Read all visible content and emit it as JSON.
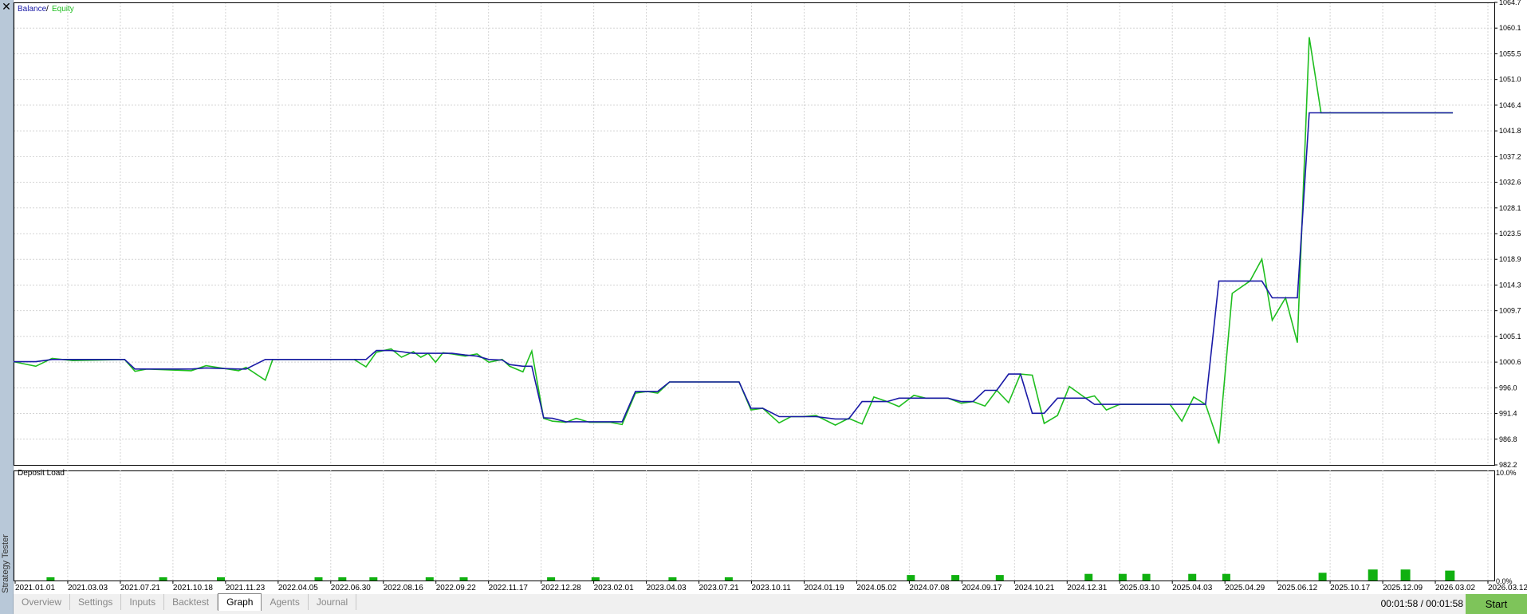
{
  "window": {
    "close_glyph": "✕",
    "side_title": "Strategy Tester"
  },
  "legend": {
    "balance": "Balance",
    "separator": " / ",
    "equity": "Equity"
  },
  "deposit": {
    "title": "Deposit Load",
    "axis_top": "10.0%",
    "axis_bottom": "0.0%"
  },
  "colors": {
    "balance": "#1a1aa6",
    "equity": "#1fbe1f",
    "deposit_bar": "#10b010",
    "grid": "#d4d4d4",
    "axis": "#000000",
    "start_button": "#7ec45a"
  },
  "chart_data": [
    {
      "type": "line",
      "title": "",
      "legend": [
        "Balance",
        "Equity"
      ],
      "y_ticks": [
        "1064.7",
        "1060.1",
        "1055.5",
        "1051.0",
        "1046.4",
        "1041.8",
        "1037.2",
        "1032.6",
        "1028.1",
        "1023.5",
        "1018.9",
        "1014.3",
        "1009.7",
        "1005.1",
        "1000.6",
        "996.0",
        "991.4",
        "986.8",
        "982.2"
      ],
      "ylim": [
        982.2,
        1064.7
      ],
      "x_ticks": [
        "2021.01.01",
        "2021.03.03",
        "2021.07.21",
        "2021.10.18",
        "2021.11.23",
        "2022.04.05",
        "2022.06.30",
        "2022.08.16",
        "2022.09.22",
        "2022.11.17",
        "2022.12.28",
        "2023.02.01",
        "2023.04.03",
        "2023.07.21",
        "2023.10.11",
        "2024.01.19",
        "2024.05.02",
        "2024.07.08",
        "2024.09.17",
        "2024.10.21",
        "2024.12.31",
        "2025.03.10",
        "2025.04.03",
        "2025.04.29",
        "2025.06.12",
        "2025.10.17",
        "2025.12.09",
        "2026.03.02",
        "2026.03.12"
      ],
      "x": [
        0,
        1.5,
        2.6,
        4,
        7.5,
        8.2,
        9,
        12,
        13,
        15.2,
        15.7,
        17,
        17.5,
        18.1,
        19,
        19.8,
        20.8,
        21.5,
        22.3,
        23,
        23.8,
        24.5,
        25.5,
        26.2,
        27,
        27.5,
        28,
        28.5,
        29,
        29.6,
        30.5,
        31.3,
        32.1,
        33,
        33.5,
        34.4,
        35,
        35.8,
        36.4,
        37.3,
        38,
        38.9,
        39.3,
        40.3,
        41.1,
        42,
        42.8,
        43.5,
        44.3,
        44.8,
        45.6,
        46.6,
        47.3,
        48.1,
        49,
        49.8,
        50.6,
        51.7,
        52.5,
        53.3,
        54.2,
        55.5,
        56.4,
        57.3,
        58.1,
        59,
        59.8,
        60.8,
        61.6,
        62.4,
        63.1,
        64,
        64.8,
        65.6,
        66.4,
        67.2,
        68,
        68.8,
        69.6,
        70.5,
        71.3,
        72.4,
        73,
        73.8,
        74.7,
        75.5,
        76.4,
        77.2,
        78.1,
        78.9,
        79.7,
        80.5,
        81.4,
        82.3,
        83.5,
        84.3,
        85,
        85.9,
        86.7,
        87.5,
        88.3,
        89,
        89.9,
        90.6,
        91.5,
        92.2,
        93,
        93.8,
        94.6,
        95.4,
        96.2,
        97.2
      ],
      "series": [
        {
          "name": "Balance",
          "values": [
            1000.6,
            1000.6,
            1001.0,
            1001.0,
            1001.0,
            999.3,
            999.3,
            999.3,
            999.5,
            999.3,
            999.3,
            1001.0,
            1001.0,
            1001.0,
            1001.0,
            1001.0,
            1001.0,
            1001.0,
            1001.0,
            1001.0,
            1001.0,
            1002.6,
            1002.6,
            1002.4,
            1002.1,
            1002.1,
            1002.1,
            1002.1,
            1002.1,
            1002.1,
            1001.8,
            1001.6,
            1001.0,
            1000.9,
            1000.1,
            999.8,
            999.8,
            990.6,
            990.5,
            989.9,
            989.9,
            989.9,
            989.9,
            989.9,
            989.9,
            995.3,
            995.3,
            995.3,
            997.0,
            997.0,
            997.0,
            997.0,
            997.0,
            997.0,
            997.0,
            992.3,
            992.3,
            990.8,
            990.8,
            990.8,
            990.8,
            990.4,
            990.4,
            993.5,
            993.5,
            993.5,
            994.1,
            994.1,
            994.1,
            994.1,
            994.1,
            993.5,
            993.5,
            995.5,
            995.5,
            998.4,
            998.4,
            991.4,
            991.4,
            994.1,
            994.1,
            994.1,
            993.0,
            993.0,
            993.0,
            993.0,
            993.0,
            993.0,
            993.0,
            993.0,
            993.0,
            993.0,
            1015.0,
            1015.0,
            1015.0,
            1015.0,
            1012.0,
            1012.0,
            1012.0,
            1045.0,
            1045.0,
            1045.0,
            1045.0,
            1045.0,
            1045.0,
            1045.0,
            1045.0,
            1045.0,
            1045.0,
            1045.0,
            1045.0,
            1045.0
          ],
          "note_skip": false
        },
        {
          "name": "Equity",
          "values": [
            1000.6,
            999.8,
            1001.2,
            1000.8,
            1001.0,
            998.9,
            999.3,
            999.0,
            999.9,
            999.0,
            999.6,
            997.3,
            1001.0,
            1001.0,
            1001.0,
            1001.0,
            1001.0,
            1001.0,
            1001.0,
            1001.0,
            999.7,
            1002.3,
            1002.9,
            1001.4,
            1002.4,
            1001.4,
            1002.1,
            1000.5,
            1002.2,
            1002.0,
            1001.6,
            1002.0,
            1000.5,
            1001.0,
            999.8,
            998.8,
            1002.5,
            990.5,
            990.0,
            989.8,
            990.5,
            989.8,
            989.8,
            989.8,
            989.4,
            995.0,
            995.3,
            995.0,
            997.0,
            997.0,
            997.0,
            997.0,
            997.0,
            997.0,
            997.0,
            992.0,
            992.3,
            989.7,
            990.8,
            990.8,
            991.0,
            989.3,
            990.5,
            989.5,
            994.3,
            993.5,
            992.6,
            994.6,
            994.1,
            994.1,
            994.1,
            993.2,
            993.5,
            992.7,
            995.5,
            993.3,
            998.4,
            998.2,
            989.6,
            991.0,
            996.2,
            994.1,
            994.5,
            992.0,
            993.0,
            993.0,
            993.0,
            993.0,
            993.0,
            990.0,
            994.3,
            993.0,
            986.0,
            1012.8,
            1015.0,
            1018.9,
            1008.0,
            1012.0,
            1004.0,
            1058.5,
            1045.0,
            1045.0,
            1045.0,
            1045.0,
            1045.0,
            1045.0,
            1045.0,
            1045.0,
            1045.0,
            1045.0,
            1045.0,
            1045.0
          ]
        }
      ]
    },
    {
      "type": "bar",
      "title": "Deposit Load",
      "y_ticks": [
        "10.0%",
        "0.0%"
      ],
      "ylim": [
        0,
        10
      ],
      "x": [
        2.5,
        10.1,
        14.0,
        20.6,
        22.2,
        24.3,
        28.1,
        30.4,
        36.3,
        39.3,
        44.5,
        48.3,
        60.6,
        63.6,
        66.6,
        72.6,
        74.9,
        76.5,
        79.6,
        81.9,
        88.4,
        91.8,
        94.0,
        97.0
      ],
      "values": [
        0.3,
        0.3,
        0.3,
        0.3,
        0.3,
        0.3,
        0.3,
        0.3,
        0.3,
        0.3,
        0.3,
        0.3,
        0.5,
        0.5,
        0.5,
        0.6,
        0.6,
        0.6,
        0.6,
        0.6,
        0.7,
        1.0,
        1.0,
        0.9
      ]
    }
  ],
  "tabs": [
    "Overview",
    "Settings",
    "Inputs",
    "Backtest",
    "Graph",
    "Agents",
    "Journal"
  ],
  "active_tab": "Graph",
  "timer": "00:01:58 / 00:01:58",
  "start_label": "Start"
}
